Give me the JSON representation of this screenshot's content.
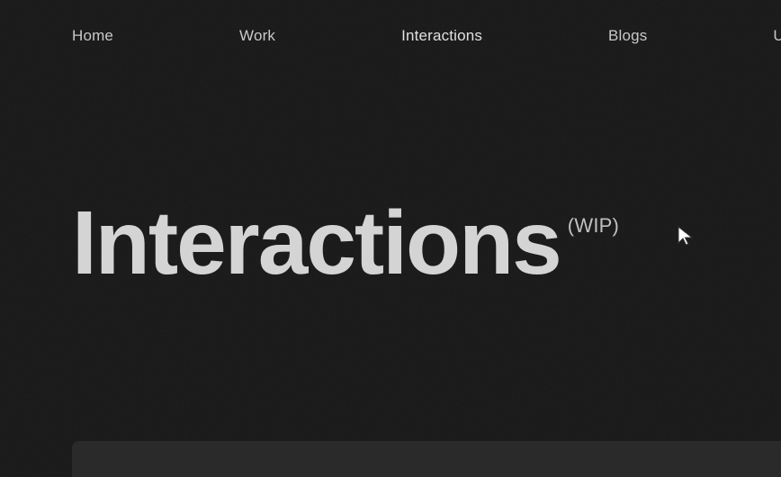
{
  "nav": {
    "items": [
      {
        "label": "Home",
        "active": false
      },
      {
        "label": "Work",
        "active": false
      },
      {
        "label": "Interactions",
        "active": true
      },
      {
        "label": "Blogs",
        "active": false
      },
      {
        "label": "Us",
        "active": false
      }
    ]
  },
  "hero": {
    "title": "Interactions",
    "wip_label": "(WIP)"
  },
  "colors": {
    "bg": "#1a1a1a",
    "nav_text": "#c8c8c8",
    "hero_text": "#d4d4d4",
    "wip_text": "#c0c0c0"
  }
}
